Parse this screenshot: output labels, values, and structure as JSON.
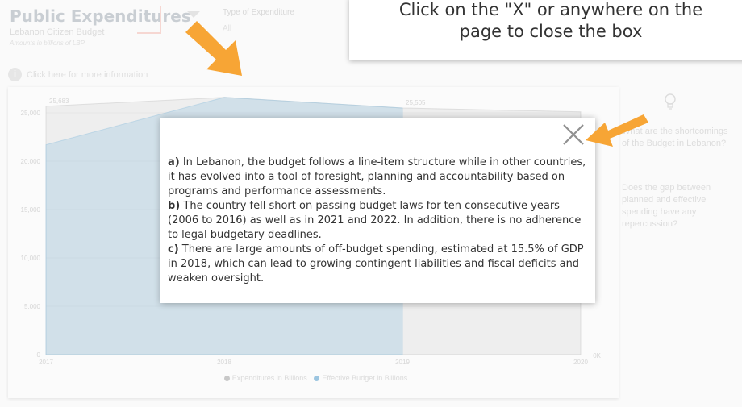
{
  "report": {
    "title": "Public Expenditures",
    "subtitle": "Lebanon Citizen Budget",
    "units_note": "Amounts in billions of LBP",
    "slicer": {
      "label": "Type of Expenditure",
      "value": "All"
    },
    "info_link": "Click here for more information",
    "info_icon": "info-icon"
  },
  "colors": {
    "arrow": "#f7a535",
    "series_expenditures": "#c8c8c8",
    "series_effective": "#9cc5e0"
  },
  "chart_data": {
    "type": "area",
    "x": [
      "2017",
      "2018",
      "2019",
      "2020"
    ],
    "ylim": [
      0,
      26000
    ],
    "yticks": [
      "0",
      "5,000",
      "10,000",
      "15,000",
      "20,000",
      "25,000"
    ],
    "right_axis_labels": [
      "0K"
    ],
    "series": [
      {
        "name": "Expenditures in Billions",
        "values": [
          25683,
          26600,
          25505,
          25100
        ]
      },
      {
        "name": "Effective Budget in Billions",
        "values": [
          21700,
          26600,
          25505,
          null
        ]
      }
    ],
    "point_labels": [
      "25,683",
      "25,505"
    ],
    "legend": "bottom-center"
  },
  "side_panel": {
    "icon": "lightbulb-icon",
    "questions": [
      "What are the shortcomings of the Budget in Lebanon?",
      "Does the gap between planned and effective spending have any repercussion?"
    ]
  },
  "banner": {
    "text": "Click on the \"X\" or anywhere on the\npage to close the box"
  },
  "modal": {
    "close_icon": "close-icon",
    "paragraphs": [
      {
        "letter": "a)",
        "text": " In Lebanon, the budget follows a line-item structure while in other countries, it has evolved into a tool of foresight, planning and accountability based on programs and performance assessments."
      },
      {
        "letter": "b)",
        "text": " The country fell short on passing budget laws for ten consecutive years (2006 to 2016) as well as in 2021 and 2022. In addition, there is no adherence to legal budgetary deadlines."
      },
      {
        "letter": "c)",
        "text": " There are large amounts of off-budget spending, estimated at 15.5% of GDP in 2018, which can lead to growing contingent liabilities and fiscal deficits and weaken oversight."
      }
    ]
  }
}
